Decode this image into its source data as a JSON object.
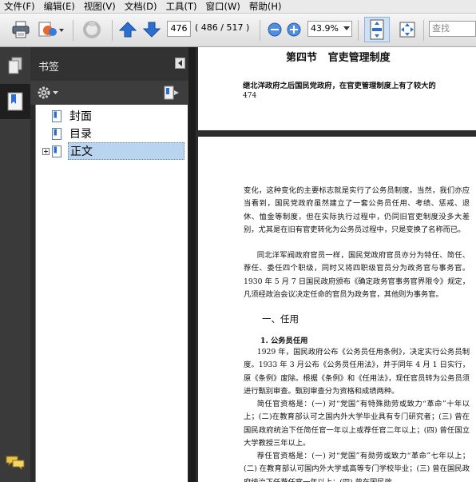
{
  "menubar": {
    "items": [
      "文件(F)",
      "编辑(E)",
      "视图(V)",
      "文档(D)",
      "工具(T)",
      "窗口(W)",
      "帮助(H)"
    ]
  },
  "toolbar": {
    "current_page": "476",
    "page_info": "( 486 / 517 )",
    "zoom": "43.9%",
    "search_placeholder": "查找"
  },
  "bookmarks": {
    "title": "书签",
    "items": [
      {
        "label": "封面",
        "selected": false,
        "expandable": false
      },
      {
        "label": "目录",
        "selected": false,
        "expandable": false
      },
      {
        "label": "正文",
        "selected": true,
        "expandable": true
      }
    ]
  },
  "document": {
    "top_page": {
      "heading": "第四节   官吏管理制度",
      "line": "继北洋政府之后国民党政府，在官吏管理制度上有了较大的",
      "page_number": "474"
    },
    "main_page": {
      "p1": "变化，这种变化的主要标志就是实行了公务员制度。当然，我们亦应当看到，国民党政府虽然建立了一套公务员任用、考绩、惩戒、退休、恤金等制度，但在实际执行过程中，仍同旧官吏制度没多大差别，尤其是在旧有官吏转化为公务员过程中，只是变换了名称而已。",
      "p2": "同北洋军阀政府官员一样，国民党政府官员亦分为特任、简任、荐任、委任四个职级，同时又将四职级官员分为政务官与事务官。1930 年 5 月 7 日国民政府颁布《确定政务官事务官界限令》规定，凡须经政治会议决定任命的官员为政务官，其他则为事务官。",
      "section": "一、任用",
      "subsection": "1. 公务员任用",
      "p3": "1929 年，国民政府公布《公务员任用条例》，决定实行公务员制度。1933 年 3 月公布《公务员任用法》，并于同年 4 月 1 日实行，原《条例》废除。根据《条例》和《任用法》，现任官员转为公务员须进行甄别审查。甄别审查分为资格和成绩两种。",
      "p4": "简任官资格是：(一) 对“党国”有特殊勋劳或致力“革命”十年以上；(二)在教育部认可之国内外大学毕业具有专门研究者；(三) 曾在国民政府统治下任简任官一年以上或荐任官二年以上；(四) 曾任国立大学教授三年以上。",
      "p5": "荐任官资格是：(一) 对“党国”有勋劳或致力“革命”七年以上；(二) 在教育部认可国内外大学或高等专门学校毕业；(三) 曾在国民政府统治下任荐任官一年以上；(四) 曾在国民政"
    }
  },
  "colors": {
    "selection": "#b9d4ef",
    "arrow_blue": "#2d6fd0",
    "panel_bg": "#323232"
  }
}
